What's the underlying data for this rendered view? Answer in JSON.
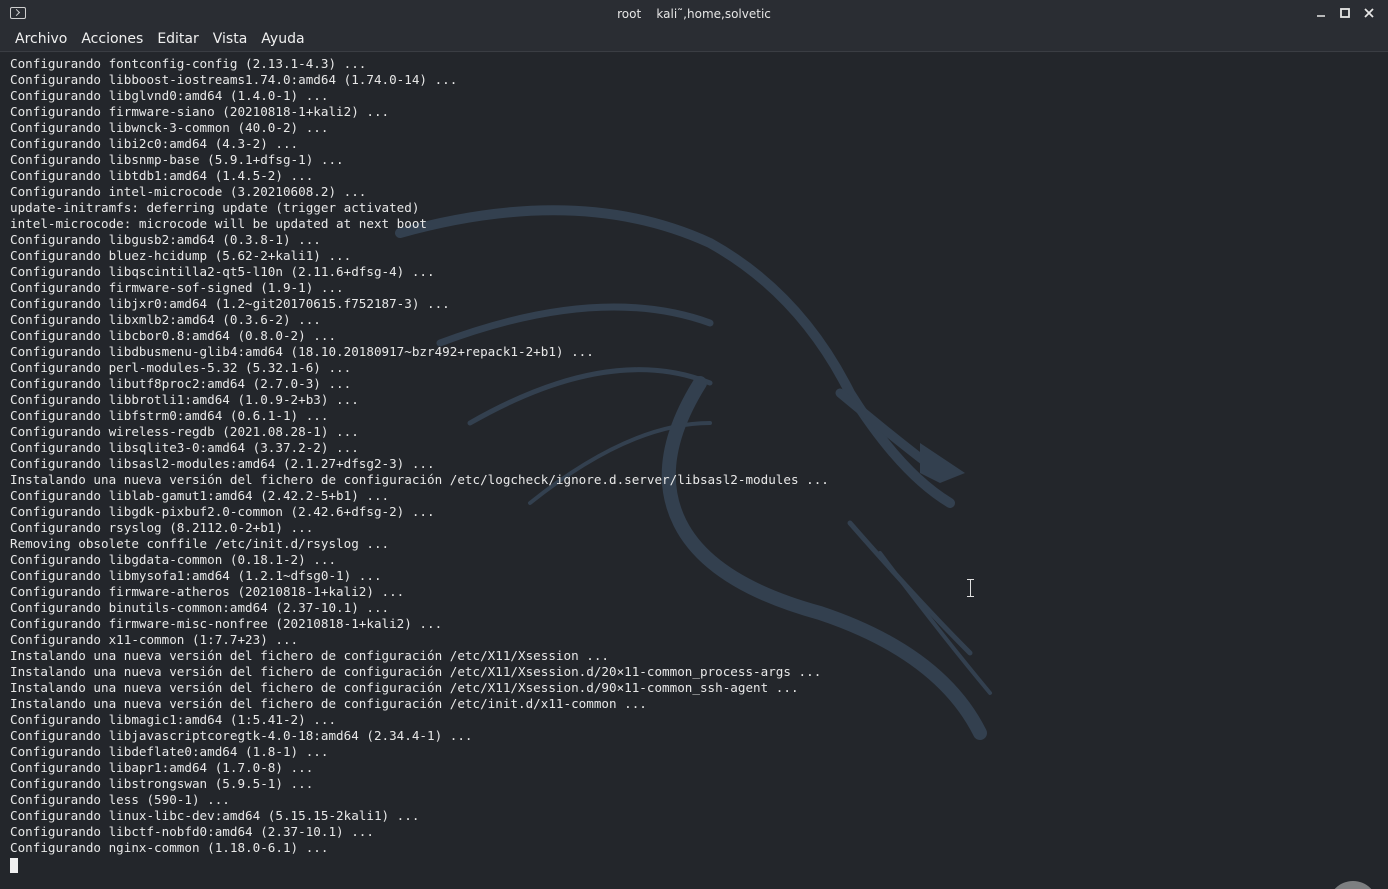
{
  "window": {
    "title": "root    kali˜,home,solvetic",
    "icons": {
      "app": "terminal-icon",
      "minimize": "minimize-icon",
      "maximize": "maximize-icon",
      "close": "close-icon"
    }
  },
  "menu": {
    "items": [
      "Archivo",
      "Acciones",
      "Editar",
      "Vista",
      "Ayuda"
    ]
  },
  "colors": {
    "background": "#23262b",
    "text": "#e8e8e8",
    "chrome": "#2a2d33"
  },
  "terminal": {
    "lines": [
      "Configurando fontconfig-config (2.13.1-4.3) ...",
      "Configurando libboost-iostreams1.74.0:amd64 (1.74.0-14) ...",
      "Configurando libglvnd0:amd64 (1.4.0-1) ...",
      "Configurando firmware-siano (20210818-1+kali2) ...",
      "Configurando libwnck-3-common (40.0-2) ...",
      "Configurando libi2c0:amd64 (4.3-2) ...",
      "Configurando libsnmp-base (5.9.1+dfsg-1) ...",
      "Configurando libtdb1:amd64 (1.4.5-2) ...",
      "Configurando intel-microcode (3.20210608.2) ...",
      "update-initramfs: deferring update (trigger activated)",
      "intel-microcode: microcode will be updated at next boot",
      "Configurando libgusb2:amd64 (0.3.8-1) ...",
      "Configurando bluez-hcidump (5.62-2+kali1) ...",
      "Configurando libqscintilla2-qt5-l10n (2.11.6+dfsg-4) ...",
      "Configurando firmware-sof-signed (1.9-1) ...",
      "Configurando libjxr0:amd64 (1.2~git20170615.f752187-3) ...",
      "Configurando libxmlb2:amd64 (0.3.6-2) ...",
      "Configurando libcbor0.8:amd64 (0.8.0-2) ...",
      "Configurando libdbusmenu-glib4:amd64 (18.10.20180917~bzr492+repack1-2+b1) ...",
      "Configurando perl-modules-5.32 (5.32.1-6) ...",
      "Configurando libutf8proc2:amd64 (2.7.0-3) ...",
      "Configurando libbrotli1:amd64 (1.0.9-2+b3) ...",
      "Configurando libfstrm0:amd64 (0.6.1-1) ...",
      "Configurando wireless-regdb (2021.08.28-1) ...",
      "Configurando libsqlite3-0:amd64 (3.37.2-2) ...",
      "Configurando libsasl2-modules:amd64 (2.1.27+dfsg2-3) ...",
      "Instalando una nueva versión del fichero de configuración /etc/logcheck/ignore.d.server/libsasl2-modules ...",
      "Configurando liblab-gamut1:amd64 (2.42.2-5+b1) ...",
      "Configurando libgdk-pixbuf2.0-common (2.42.6+dfsg-2) ...",
      "Configurando rsyslog (8.2112.0-2+b1) ...",
      "Removing obsolete conffile /etc/init.d/rsyslog ...",
      "Configurando libgdata-common (0.18.1-2) ...",
      "Configurando libmysofa1:amd64 (1.2.1~dfsg0-1) ...",
      "Configurando firmware-atheros (20210818-1+kali2) ...",
      "Configurando binutils-common:amd64 (2.37-10.1) ...",
      "Configurando firmware-misc-nonfree (20210818-1+kali2) ...",
      "Configurando x11-common (1:7.7+23) ...",
      "Instalando una nueva versión del fichero de configuración /etc/X11/Xsession ...",
      "Instalando una nueva versión del fichero de configuración /etc/X11/Xsession.d/20×11-common_process-args ...",
      "Instalando una nueva versión del fichero de configuración /etc/X11/Xsession.d/90×11-common_ssh-agent ...",
      "Instalando una nueva versión del fichero de configuración /etc/init.d/x11-common ...",
      "Configurando libmagic1:amd64 (1:5.41-2) ...",
      "Configurando libjavascriptcoregtk-4.0-18:amd64 (2.34.4-1) ...",
      "Configurando libdeflate0:amd64 (1.8-1) ...",
      "Configurando libapr1:amd64 (1.7.0-8) ...",
      "Configurando libstrongswan (5.9.5-1) ...",
      "Configurando less (590-1) ...",
      "Configurando linux-libc-dev:amd64 (5.15.15-2kali1) ...",
      "Configurando libctf-nobfd0:amd64 (2.37-10.1) ...",
      "Configurando nginx-common (1.18.0-6.1) ..."
    ]
  }
}
